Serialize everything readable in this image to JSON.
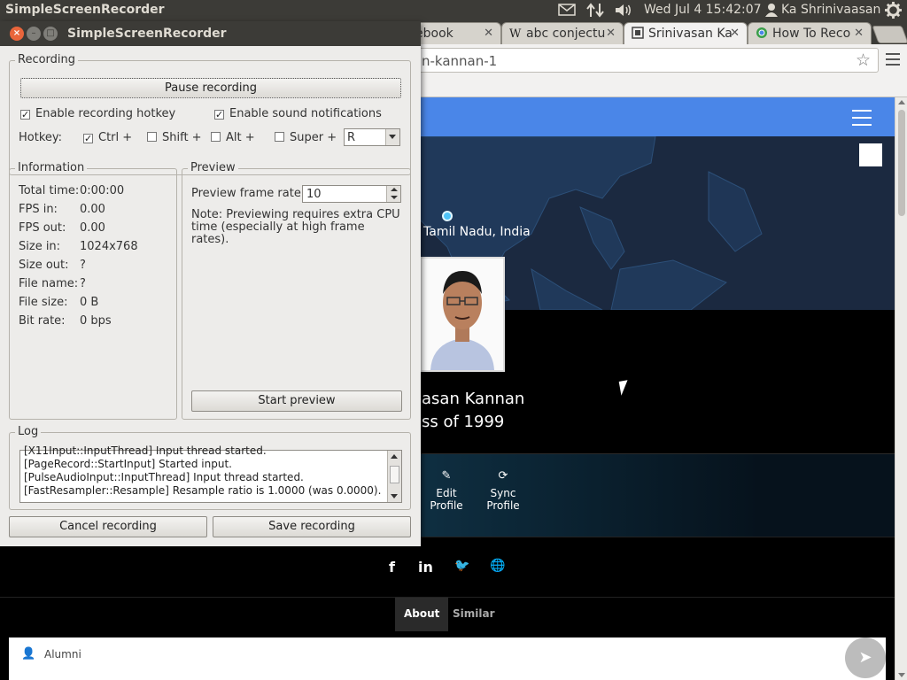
{
  "topbar": {
    "app_title": "SimpleScreenRecorder",
    "clock": "Wed Jul  4 15:42:07",
    "user": "Ka Shrinivaasan",
    "icons": [
      "mail-icon",
      "network-icon",
      "volume-icon",
      "user-icon",
      "gear-icon"
    ]
  },
  "browser": {
    "tabs": [
      {
        "label": "ebook",
        "active": false
      },
      {
        "label": "abc conjectu",
        "active": false
      },
      {
        "label": "Srinivasan Ka",
        "active": true
      },
      {
        "label": "How To Reco",
        "active": false
      }
    ],
    "tab_close": "✕",
    "url": "n-kannan-1",
    "page": {
      "map_label": "Tamil Nadu, India",
      "name": "asan Kannan",
      "class_of": "ss of 1999",
      "actions": [
        {
          "line1": "Edit",
          "line2": "Profile"
        },
        {
          "line1": "Sync",
          "line2": "Profile"
        }
      ],
      "social_icons": [
        "facebook-icon",
        "linkedin-icon",
        "twitter-icon",
        "globe-icon"
      ],
      "social_glyphs": [
        "f",
        "in",
        "🐦",
        "🌐"
      ],
      "tabs": [
        "About",
        "Similar"
      ],
      "alumni": "Alumni"
    }
  },
  "ssr": {
    "window_title": "SimpleScreenRecorder",
    "recording": {
      "group_label": "Recording",
      "pause_button": "Pause recording",
      "enable_hotkey": {
        "label": "Enable recording hotkey",
        "checked": true
      },
      "sound_notifications": {
        "label": "Enable sound notifications",
        "checked": true
      },
      "hotkey_label": "Hotkey:",
      "ctrl": {
        "label": "Ctrl +",
        "checked": true
      },
      "shift": {
        "label": "Shift +",
        "checked": false
      },
      "alt": {
        "label": "Alt +",
        "checked": false
      },
      "super": {
        "label": "Super +",
        "checked": false
      },
      "key_value": "R"
    },
    "information": {
      "group_label": "Information",
      "rows": [
        {
          "key": "Total time:",
          "value": "0:00:00"
        },
        {
          "key": "FPS in:",
          "value": "0.00"
        },
        {
          "key": "FPS out:",
          "value": "0.00"
        },
        {
          "key": "Size in:",
          "value": "1024x768"
        },
        {
          "key": "Size out:",
          "value": "?"
        },
        {
          "key": "File name:",
          "value": "?"
        },
        {
          "key": "File size:",
          "value": "0 B"
        },
        {
          "key": "Bit rate:",
          "value": "0 bps"
        }
      ]
    },
    "preview": {
      "group_label": "Preview",
      "frame_rate_label": "Preview frame rate:",
      "frame_rate_value": "10",
      "note": "Note: Previewing requires extra CPU time (especially at high frame rates).",
      "start_button": "Start preview"
    },
    "log": {
      "group_label": "Log",
      "lines": [
        "[X11Input::InputThread] Input thread started.",
        "[PageRecord::StartInput] Started input.",
        "[PulseAudioInput::InputThread] Input thread started.",
        "[FastResampler::Resample] Resample ratio is 1.0000 (was 0.0000)."
      ]
    },
    "cancel_button": "Cancel recording",
    "save_button": "Save recording"
  },
  "colors": {
    "panel": "#3c3b37",
    "window_bg": "#edecea",
    "site_header": "#4a86e8",
    "close_button": "#e9653b"
  }
}
